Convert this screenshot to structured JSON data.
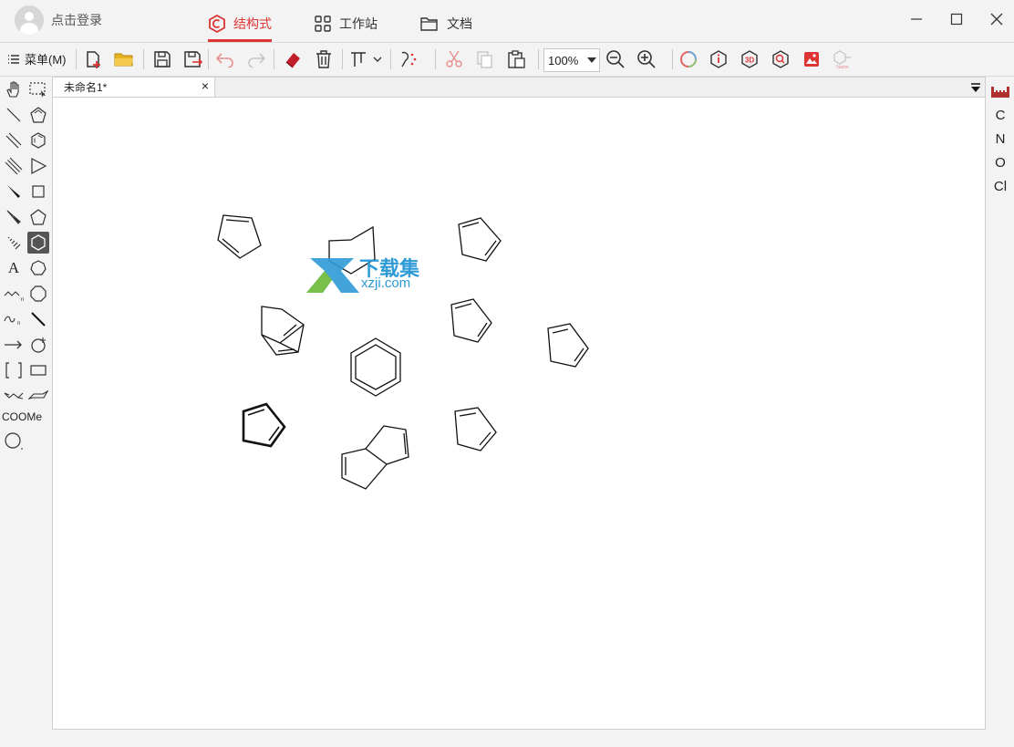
{
  "titlebar": {
    "login_label": "点击登录",
    "tabs": [
      {
        "label": "结构式",
        "active": true
      },
      {
        "label": "工作站",
        "active": false
      },
      {
        "label": "文档",
        "active": false
      }
    ],
    "accent_color": "#d33333"
  },
  "toolbar": {
    "menu_label": "菜单(M)",
    "zoom_value": "100%"
  },
  "tools": {
    "text_tool_label": "A",
    "abbrev_label": "COOMe"
  },
  "document": {
    "tab_label": "未命名1*",
    "tab_close": "×"
  },
  "watermark": {
    "title": "下载集",
    "url": "xzji.com"
  },
  "elements": [
    "C",
    "N",
    "O",
    "Cl"
  ],
  "icons": {
    "new_file": "new-file-icon",
    "open": "folder-icon",
    "save": "save-icon",
    "save_as": "save-as-icon",
    "undo": "undo-icon",
    "redo": "redo-icon",
    "eraser": "eraser-icon",
    "delete": "trash-icon",
    "zoom_out": "zoom-out-icon",
    "zoom_in": "zoom-in-icon",
    "periodic_table": "periodic-table-icon"
  }
}
